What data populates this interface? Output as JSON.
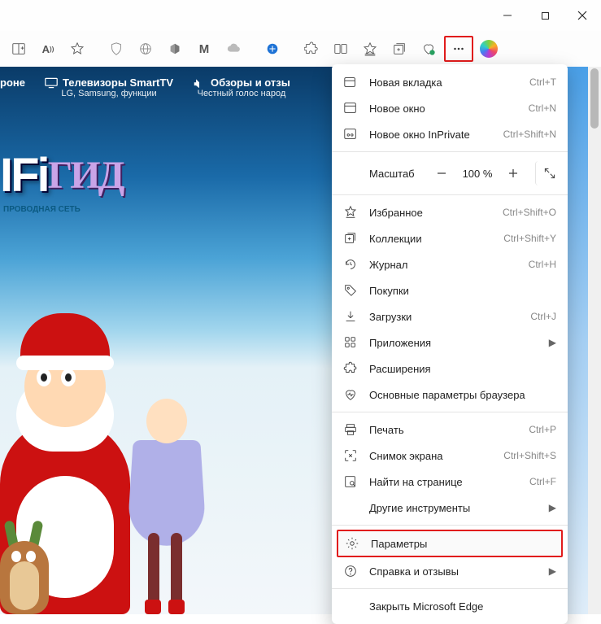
{
  "window": {
    "minimize": "—",
    "maximize": "☐",
    "close": "✕"
  },
  "nav": {
    "item1_top": "роне",
    "item2_top": "Телевизоры SmartTV",
    "item2_sub": "LG, Samsung, функции",
    "item3_top": "Обзоры и отзы",
    "item3_sub": "Честный голос народ"
  },
  "logo": {
    "main": "IFi",
    "gid": "ГИД",
    "sub": "ПРОВОДНАЯ СЕТЬ"
  },
  "zoom": {
    "label": "Масштаб",
    "value": "100 %"
  },
  "menu": {
    "new_tab": "Новая вкладка",
    "new_tab_sc": "Ctrl+T",
    "new_window": "Новое окно",
    "new_window_sc": "Ctrl+N",
    "inprivate": "Новое окно InPrivate",
    "inprivate_sc": "Ctrl+Shift+N",
    "favorites": "Избранное",
    "favorites_sc": "Ctrl+Shift+O",
    "collections": "Коллекции",
    "collections_sc": "Ctrl+Shift+Y",
    "history": "Журнал",
    "history_sc": "Ctrl+H",
    "shopping": "Покупки",
    "downloads": "Загрузки",
    "downloads_sc": "Ctrl+J",
    "apps": "Приложения",
    "extensions": "Расширения",
    "perf": "Основные параметры браузера",
    "print": "Печать",
    "print_sc": "Ctrl+P",
    "screenshot": "Снимок экрана",
    "screenshot_sc": "Ctrl+Shift+S",
    "find": "Найти на странице",
    "find_sc": "Ctrl+F",
    "more_tools": "Другие инструменты",
    "settings": "Параметры",
    "help": "Справка и отзывы",
    "close_edge": "Закрыть Microsoft Edge"
  }
}
